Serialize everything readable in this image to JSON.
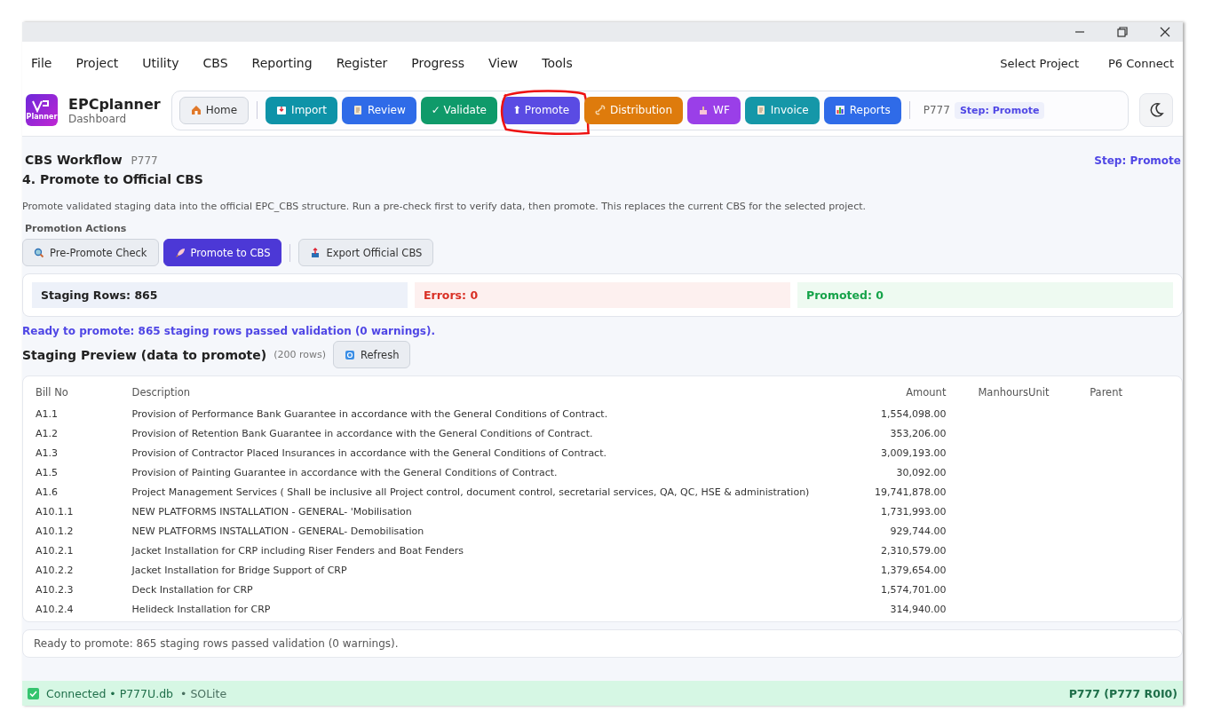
{
  "menu": [
    "File",
    "Project",
    "Utility",
    "CBS",
    "Reporting",
    "Register",
    "Progress",
    "View",
    "Tools"
  ],
  "menu_right": [
    "Select Project",
    "P6 Connect"
  ],
  "app": {
    "name": "EPCplanner",
    "subtitle": "Dashboard",
    "logo_text": "Planner"
  },
  "toolbar": [
    {
      "label": "Home",
      "kind": "plain",
      "highlighted": false
    },
    {
      "label": "Import",
      "kind": "colored",
      "color": "#0e93a8",
      "highlighted": false
    },
    {
      "label": "Review",
      "kind": "colored",
      "color": "#2f6be8",
      "highlighted": false
    },
    {
      "label": "✓ Validate",
      "kind": "colored",
      "color": "#0f9a6a",
      "highlighted": false
    },
    {
      "label": "⬆ Promote",
      "kind": "colored",
      "color": "#5a4be3",
      "highlighted": true
    },
    {
      "label": "Distribution",
      "kind": "colored",
      "color": "#de7b0c",
      "highlighted": false
    },
    {
      "label": "WF",
      "kind": "colored",
      "color": "#9a3fe8",
      "highlighted": false
    },
    {
      "label": "Invoice",
      "kind": "colored",
      "color": "#1597a8",
      "highlighted": false
    },
    {
      "label": "Reports",
      "kind": "colored",
      "color": "#2f6be8",
      "highlighted": false
    }
  ],
  "toolbar_project": "P777",
  "toolbar_step": "Step: Promote",
  "workflow": {
    "title": "CBS Workflow",
    "project": "P777",
    "step": "Step: Promote"
  },
  "heading": "4. Promote to Official CBS",
  "description": "Promote validated staging data into the official EPC_CBS structure. Run a pre-check first to verify data, then promote. This replaces the current CBS for the selected project.",
  "actions_label": "Promotion Actions",
  "actions": [
    {
      "label": "Pre-Promote Check",
      "kind": "secondary"
    },
    {
      "label": "Promote to CBS",
      "kind": "primary"
    },
    {
      "label": "Export Official CBS",
      "kind": "secondary"
    }
  ],
  "stats": [
    {
      "label": "Staging Rows: 865",
      "kind": "neutral"
    },
    {
      "label": "Errors: 0",
      "kind": "error"
    },
    {
      "label": "Promoted: 0",
      "kind": "success"
    }
  ],
  "ready_message": "Ready to promote: 865 staging rows passed validation (0 warnings).",
  "preview": {
    "title": "Staging Preview (data to promote)",
    "count": "(200 rows)",
    "refresh": "Refresh"
  },
  "table": {
    "columns": [
      "Bill No",
      "Description",
      "Amount",
      "ManhoursUnit",
      "Parent"
    ],
    "rows": [
      [
        "A1.1",
        "Provision of Performance Bank Guarantee in accordance with the General Conditions of Contract.",
        "1,554,098.00"
      ],
      [
        "A1.2",
        "Provision of Retention Bank Guarantee in accordance with the General Conditions of Contract.",
        "353,206.00"
      ],
      [
        "A1.3",
        "Provision of Contractor Placed Insurances  in accordance with the General Conditions of Contract.",
        "3,009,193.00"
      ],
      [
        "A1.5",
        "Provision of Painting Guarantee in accordance with the General Conditions of Contract.",
        "30,092.00"
      ],
      [
        "A1.6",
        "Project Management Services ( Shall be inclusive all Project control, document control, secretarial services, QA, QC, HSE & administration)",
        "19,741,878.00"
      ],
      [
        "A10.1.1",
        "NEW PLATFORMS INSTALLATION - GENERAL- 'Mobilisation",
        "1,731,993.00"
      ],
      [
        "A10.1.2",
        "NEW PLATFORMS INSTALLATION - GENERAL- Demobilisation",
        "929,744.00"
      ],
      [
        "A10.2.1",
        "Jacket Installation for CRP including Riser Fenders and Boat Fenders",
        "2,310,579.00"
      ],
      [
        "A10.2.2",
        "Jacket Installation for Bridge Support of CRP",
        "1,379,654.00"
      ],
      [
        "A10.2.3",
        "Deck Installation for CRP",
        "1,574,701.00"
      ],
      [
        "A10.2.4",
        "Helideck Installation for CRP",
        "314,940.00"
      ]
    ]
  },
  "footer_message": "Ready to promote: 865 staging rows passed validation (0 warnings).",
  "status_bar": {
    "connected": true,
    "connection": "Connected • P777U.db",
    "db": "•  SOLite",
    "project": "P777 (P777  R0I0)"
  }
}
